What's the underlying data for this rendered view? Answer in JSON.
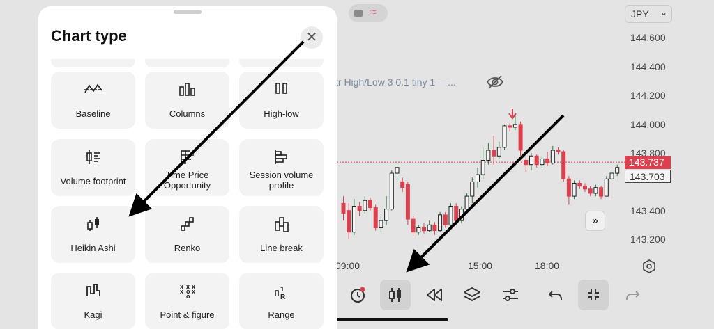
{
  "header": {
    "currency": "JPY"
  },
  "chart": {
    "price_labels": [
      "144.600",
      "144.400",
      "144.200",
      "144.000",
      "143.800",
      "143.400",
      "143.200"
    ],
    "last_price_red": "143.737",
    "last_price_white": "143.703",
    "time_labels": [
      "09:00",
      "15:00",
      "18:00"
    ],
    "indicator_text": "tr High/Low 3 0.1 tiny 1 —...",
    "colors": {
      "up": "#1f1f1f",
      "down": "#d9414f",
      "background": "#e4e4e4"
    }
  },
  "chart_data": {
    "type": "candlestick",
    "price_ticks": [
      144.6,
      144.4,
      144.2,
      144.0,
      143.8,
      143.4,
      143.2
    ],
    "time_ticks": [
      "09:00",
      "15:00",
      "18:00"
    ],
    "last_price": 143.737,
    "price_tag_2": 143.703,
    "candles": [
      {
        "o": 143.45,
        "c": 143.38,
        "h": 143.5,
        "l": 143.33
      },
      {
        "o": 143.4,
        "c": 143.25,
        "h": 143.45,
        "l": 143.2
      },
      {
        "o": 143.25,
        "c": 143.43,
        "h": 143.48,
        "l": 143.23
      },
      {
        "o": 143.43,
        "c": 143.4,
        "h": 143.46,
        "l": 143.36
      },
      {
        "o": 143.4,
        "c": 143.47,
        "h": 143.5,
        "l": 143.38
      },
      {
        "o": 143.47,
        "c": 143.42,
        "h": 143.49,
        "l": 143.4
      },
      {
        "o": 143.42,
        "c": 143.28,
        "h": 143.44,
        "l": 143.26
      },
      {
        "o": 143.28,
        "c": 143.33,
        "h": 143.36,
        "l": 143.25
      },
      {
        "o": 143.33,
        "c": 143.41,
        "h": 143.5,
        "l": 143.3
      },
      {
        "o": 143.41,
        "c": 143.66,
        "h": 143.68,
        "l": 143.4
      },
      {
        "o": 143.66,
        "c": 143.7,
        "h": 143.73,
        "l": 143.62
      },
      {
        "o": 143.6,
        "c": 143.56,
        "h": 143.63,
        "l": 143.53
      },
      {
        "o": 143.58,
        "c": 143.34,
        "h": 143.6,
        "l": 143.3
      },
      {
        "o": 143.34,
        "c": 143.25,
        "h": 143.36,
        "l": 143.22
      },
      {
        "o": 143.25,
        "c": 143.28,
        "h": 143.3,
        "l": 143.23
      },
      {
        "o": 143.28,
        "c": 143.26,
        "h": 143.31,
        "l": 143.24
      },
      {
        "o": 143.26,
        "c": 143.3,
        "h": 143.33,
        "l": 143.25
      },
      {
        "o": 143.3,
        "c": 143.26,
        "h": 143.32,
        "l": 143.23
      },
      {
        "o": 143.26,
        "c": 143.37,
        "h": 143.39,
        "l": 143.25
      },
      {
        "o": 143.37,
        "c": 143.3,
        "h": 143.39,
        "l": 143.28
      },
      {
        "o": 143.3,
        "c": 143.43,
        "h": 143.45,
        "l": 143.29
      },
      {
        "o": 143.43,
        "c": 143.33,
        "h": 143.45,
        "l": 143.3
      },
      {
        "o": 143.33,
        "c": 143.41,
        "h": 143.43,
        "l": 143.31
      },
      {
        "o": 143.41,
        "c": 143.5,
        "h": 143.52,
        "l": 143.4
      },
      {
        "o": 143.5,
        "c": 143.6,
        "h": 143.63,
        "l": 143.45
      },
      {
        "o": 143.6,
        "c": 143.65,
        "h": 143.7,
        "l": 143.56
      },
      {
        "o": 143.65,
        "c": 143.75,
        "h": 143.84,
        "l": 143.62
      },
      {
        "o": 143.75,
        "c": 143.82,
        "h": 143.87,
        "l": 143.72
      },
      {
        "o": 143.82,
        "c": 143.78,
        "h": 143.92,
        "l": 143.72
      },
      {
        "o": 143.78,
        "c": 143.84,
        "h": 143.88,
        "l": 143.76
      },
      {
        "o": 143.84,
        "c": 143.99,
        "h": 144.0,
        "l": 143.82
      },
      {
        "o": 143.99,
        "c": 143.98,
        "h": 144.01,
        "l": 143.95
      },
      {
        "o": 143.98,
        "c": 144.0,
        "h": 144.07,
        "l": 143.96
      },
      {
        "o": 144.0,
        "c": 143.82,
        "h": 144.02,
        "l": 143.78
      },
      {
        "o": 143.75,
        "c": 143.72,
        "h": 143.77,
        "l": 143.67
      },
      {
        "o": 143.72,
        "c": 143.78,
        "h": 143.8,
        "l": 143.68
      },
      {
        "o": 143.78,
        "c": 143.72,
        "h": 143.79,
        "l": 143.7
      },
      {
        "o": 143.72,
        "c": 143.76,
        "h": 143.78,
        "l": 143.7
      },
      {
        "o": 143.76,
        "c": 143.73,
        "h": 143.81,
        "l": 143.71
      },
      {
        "o": 143.73,
        "c": 143.82,
        "h": 143.85,
        "l": 143.72
      },
      {
        "o": 143.82,
        "c": 143.81,
        "h": 143.84,
        "l": 143.79
      },
      {
        "o": 143.81,
        "c": 143.62,
        "h": 143.82,
        "l": 143.6
      },
      {
        "o": 143.62,
        "c": 143.5,
        "h": 143.64,
        "l": 143.44
      },
      {
        "o": 143.5,
        "c": 143.59,
        "h": 143.61,
        "l": 143.48
      },
      {
        "o": 143.59,
        "c": 143.57,
        "h": 143.61,
        "l": 143.55
      },
      {
        "o": 143.57,
        "c": 143.55,
        "h": 143.59,
        "l": 143.53
      },
      {
        "o": 143.55,
        "c": 143.52,
        "h": 143.57,
        "l": 143.5
      },
      {
        "o": 143.52,
        "c": 143.56,
        "h": 143.58,
        "l": 143.5
      },
      {
        "o": 143.56,
        "c": 143.5,
        "h": 143.57,
        "l": 143.48
      },
      {
        "o": 143.5,
        "c": 143.62,
        "h": 143.64,
        "l": 143.5
      },
      {
        "o": 143.62,
        "c": 143.66,
        "h": 143.68,
        "l": 143.6
      },
      {
        "o": 143.66,
        "c": 143.7,
        "h": 143.72,
        "l": 143.64
      }
    ]
  },
  "sheet": {
    "title": "Chart type",
    "close_icon": "close-icon",
    "tiles": [
      {
        "label": "Baseline",
        "icon": "baseline-icon"
      },
      {
        "label": "Columns",
        "icon": "columns-icon"
      },
      {
        "label": "High-low",
        "icon": "high-low-icon"
      },
      {
        "label": "Volume footprint",
        "icon": "volume-footprint-icon"
      },
      {
        "label": "Time Price Opportunity",
        "icon": "tpo-icon"
      },
      {
        "label": "Session volume profile",
        "icon": "session-volume-icon"
      },
      {
        "label": "Heikin Ashi",
        "icon": "heikin-ashi-icon"
      },
      {
        "label": "Renko",
        "icon": "renko-icon"
      },
      {
        "label": "Line break",
        "icon": "line-break-icon"
      },
      {
        "label": "Kagi",
        "icon": "kagi-icon"
      },
      {
        "label": "Point & figure",
        "icon": "point-figure-icon"
      },
      {
        "label": "Range",
        "icon": "range-icon"
      }
    ]
  },
  "toolbar": {
    "icons": [
      "alarm-clock-icon",
      "candles-icon",
      "rewind-icon",
      "layers-icon",
      "sliders-icon",
      "undo-icon",
      "collapse-icon",
      "redo-icon"
    ]
  }
}
